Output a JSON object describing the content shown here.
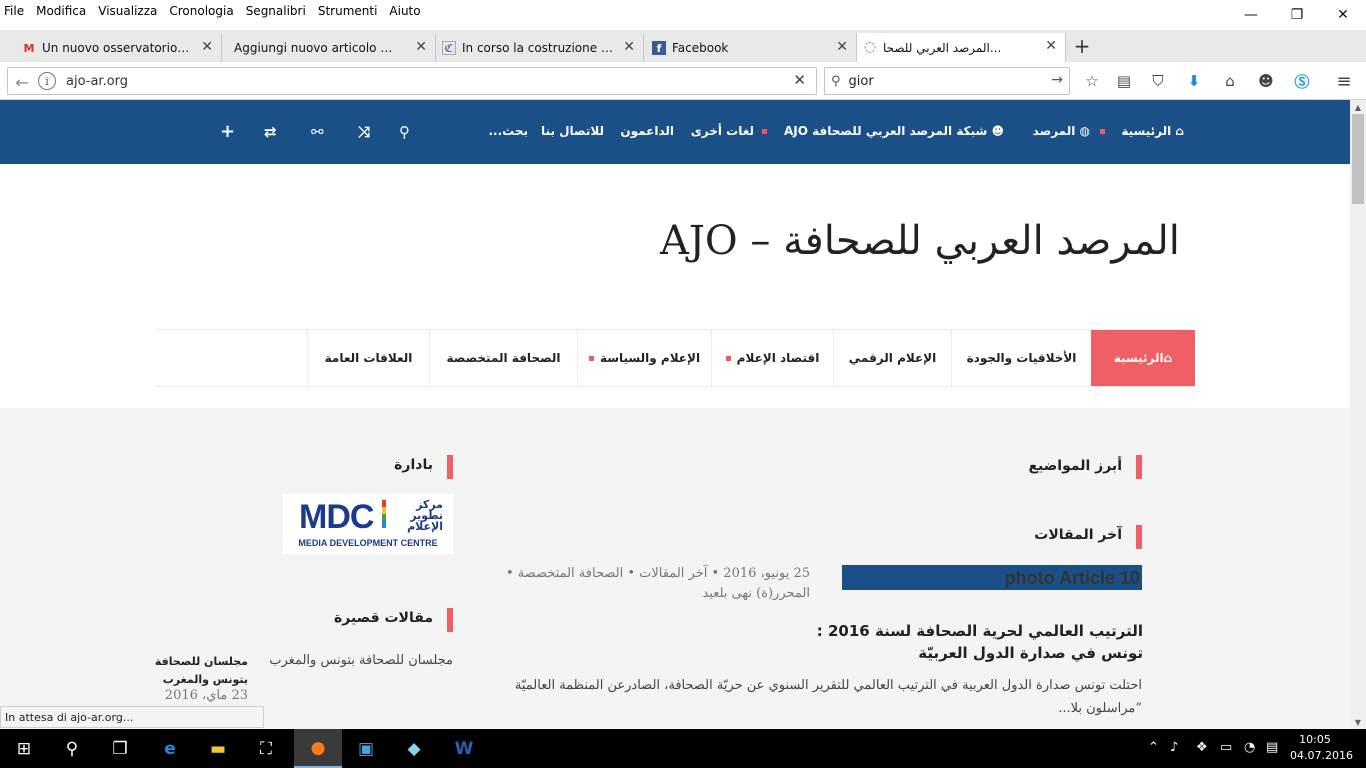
{
  "menubar": [
    "File",
    "Modifica",
    "Visualizza",
    "Cronologia",
    "Segnalibri",
    "Strumenti",
    "Aiuto"
  ],
  "tabs": [
    {
      "title": "Un nuovo osservatorio sul...",
      "favicon": "gmail-icon",
      "fav_glyph": "M",
      "color": "#d93025"
    },
    {
      "title": "Aggiungi nuovo articolo ‹ Etici...",
      "favicon": "wordpress-icon",
      "fav_glyph": "",
      "color": "#888888"
    },
    {
      "title": "In corso la costruzione del...",
      "favicon": "site-icon",
      "fav_glyph": "ℭ",
      "color": "#7b5ea7"
    },
    {
      "title": "Facebook",
      "favicon": "facebook-icon",
      "fav_glyph": "f",
      "color": "#3b5998"
    },
    {
      "title": "المرصد العربي للصحا...",
      "favicon": "loading-icon",
      "fav_glyph": "◌",
      "color": "#1e88e5"
    }
  ],
  "navbar": {
    "url": "ajo-ar.org",
    "search_value": "gior"
  },
  "site": {
    "top_nav": [
      {
        "label": " الرئيسية",
        "icon": "home-icon"
      },
      {
        "label": " المرصد",
        "icon": "globe-icon"
      },
      {
        "label": " شبكة المرصد العربي للصحافة AJO",
        "icon": "users-icon"
      },
      {
        "label": "لغات أخرى"
      },
      {
        "label": "الداعمون"
      },
      {
        "label": "للاتصال بنا"
      }
    ],
    "search_placeholder": "بحث...",
    "title": "المرصد العربي للصحافة – AJO",
    "main_nav": [
      {
        "label": " الرئيسية"
      },
      {
        "label": "الأخلاقيات والجودة"
      },
      {
        "label": "الإعلام الرقمي"
      },
      {
        "label": "اقتصاد الإعلام"
      },
      {
        "label": "الإعلام والسياسة"
      },
      {
        "label": "الصحافة المتخصصة"
      },
      {
        "label": "العلاقات العامة"
      }
    ],
    "sections": {
      "featured": "أبرز المواضيع",
      "latest": "آخر المقالات",
      "initiative": "بادارة",
      "short": "مقالات قصيرة"
    },
    "mdc": {
      "big": "MDC",
      "arabic": "مركز تطوير الإعلام",
      "caption": "MEDIA DEVELOPMENT CENTRE"
    },
    "article": {
      "photo_label": "photo Article 10",
      "meta1": "25 يونيو، 2016 • آخر المقالات • الصحافة المتخصصة •",
      "meta2": "المحرر(ة) نهى بلعيد",
      "title_line1": "الترتيب العالمي لحرية الصحافة لسنة 2016 :",
      "title_line2": "تونس في صدارة الدول العربيّة",
      "excerpt": "احتلت تونس صدارة الدول العربية في الترتيب العالمي للتقرير السنوي عن حريّة الصحافة، الصادرعن المنظمة العالميّة ”مراسلون بلا..."
    },
    "short_article": {
      "thumb_title": "مجلسان للصحافة بتونس والمغرب",
      "title": "مجلسان للصحافة بتونس والمغرب",
      "date": "23 ماي، 2016"
    }
  },
  "status_text": "In attesa di ajo-ar.org...",
  "clock": {
    "time": "10:05",
    "date": "04.07.2016"
  },
  "colors": {
    "nav_blue": "#1a4f87",
    "accent_red": "#f05e66"
  }
}
